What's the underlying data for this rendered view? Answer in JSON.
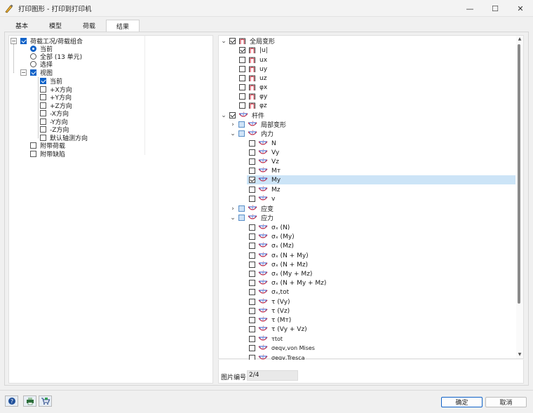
{
  "window": {
    "title": "打印图形 - 打印到打印机",
    "minimize": "—",
    "maximize": "☐",
    "close": "✕"
  },
  "tabs": [
    "基本",
    "模型",
    "荷载",
    "结果"
  ],
  "left_tree": {
    "load_group_label": "荷载工况/荷载组合",
    "current": "当前",
    "all": "全部 (13 单元)",
    "select": "选择",
    "view_label": "视图",
    "view_current": "当前",
    "plus_x": "+X方向",
    "plus_y": "+Y方向",
    "plus_z": "+Z方向",
    "minus_x": "-X方向",
    "minus_y": "-Y方向",
    "minus_z": "-Z方向",
    "default_axis": "默认轴测方向",
    "with_loads": "附带荷载",
    "with_defects": "附带缺陷"
  },
  "right_tree": {
    "global_deform": "全局变形",
    "u_abs": "|u|",
    "ux": "ux",
    "uy": "uy",
    "uz": "uz",
    "phix": "φx",
    "phiy": "φy",
    "phiz": "φz",
    "members": "杆件",
    "local_deform": "局部变形",
    "internal_forces": "内力",
    "N": "N",
    "Vy": "Vy",
    "Vz": "Vz",
    "MT": "Mт",
    "My": "My",
    "Mz": "Mz",
    "v": "v",
    "strain": "应变",
    "stress": "应力",
    "s_N": "σₓ (N)",
    "s_My": "σₓ (My)",
    "s_Mz": "σₓ (Mz)",
    "s_N_My": "σₓ (N + My)",
    "s_N_Mz": "σₓ (N + Mz)",
    "s_My_Mz": "σₓ (My + Mz)",
    "s_N_My_Mz": "σₓ (N + My + Mz)",
    "s_tot": "σₓ,tot",
    "t_Vy": "τ (Vy)",
    "t_Vz": "τ (Vz)",
    "t_MT": "τ (Mт)",
    "t_Vy_Vz": "τ (Vy + Vz)",
    "t_tot": "τtot",
    "s_vm": "σeqv,von Mises",
    "s_tresca": "σeqv,Tresca"
  },
  "picture_number_label": "图片编号:",
  "picture_number_value": "2/4",
  "buttons": {
    "ok": "确定",
    "cancel": "取消"
  },
  "icons": {
    "frame": "frame-deform-icon",
    "beam": "member-beam-icon",
    "help": "help-icon",
    "print": "printer-icon",
    "cart": "cart-icon"
  },
  "colors": {
    "accent": "#0f62c8",
    "selected_row": "#cce4f7",
    "icon_red": "#d0273a",
    "icon_blue": "#3a5fcd"
  }
}
